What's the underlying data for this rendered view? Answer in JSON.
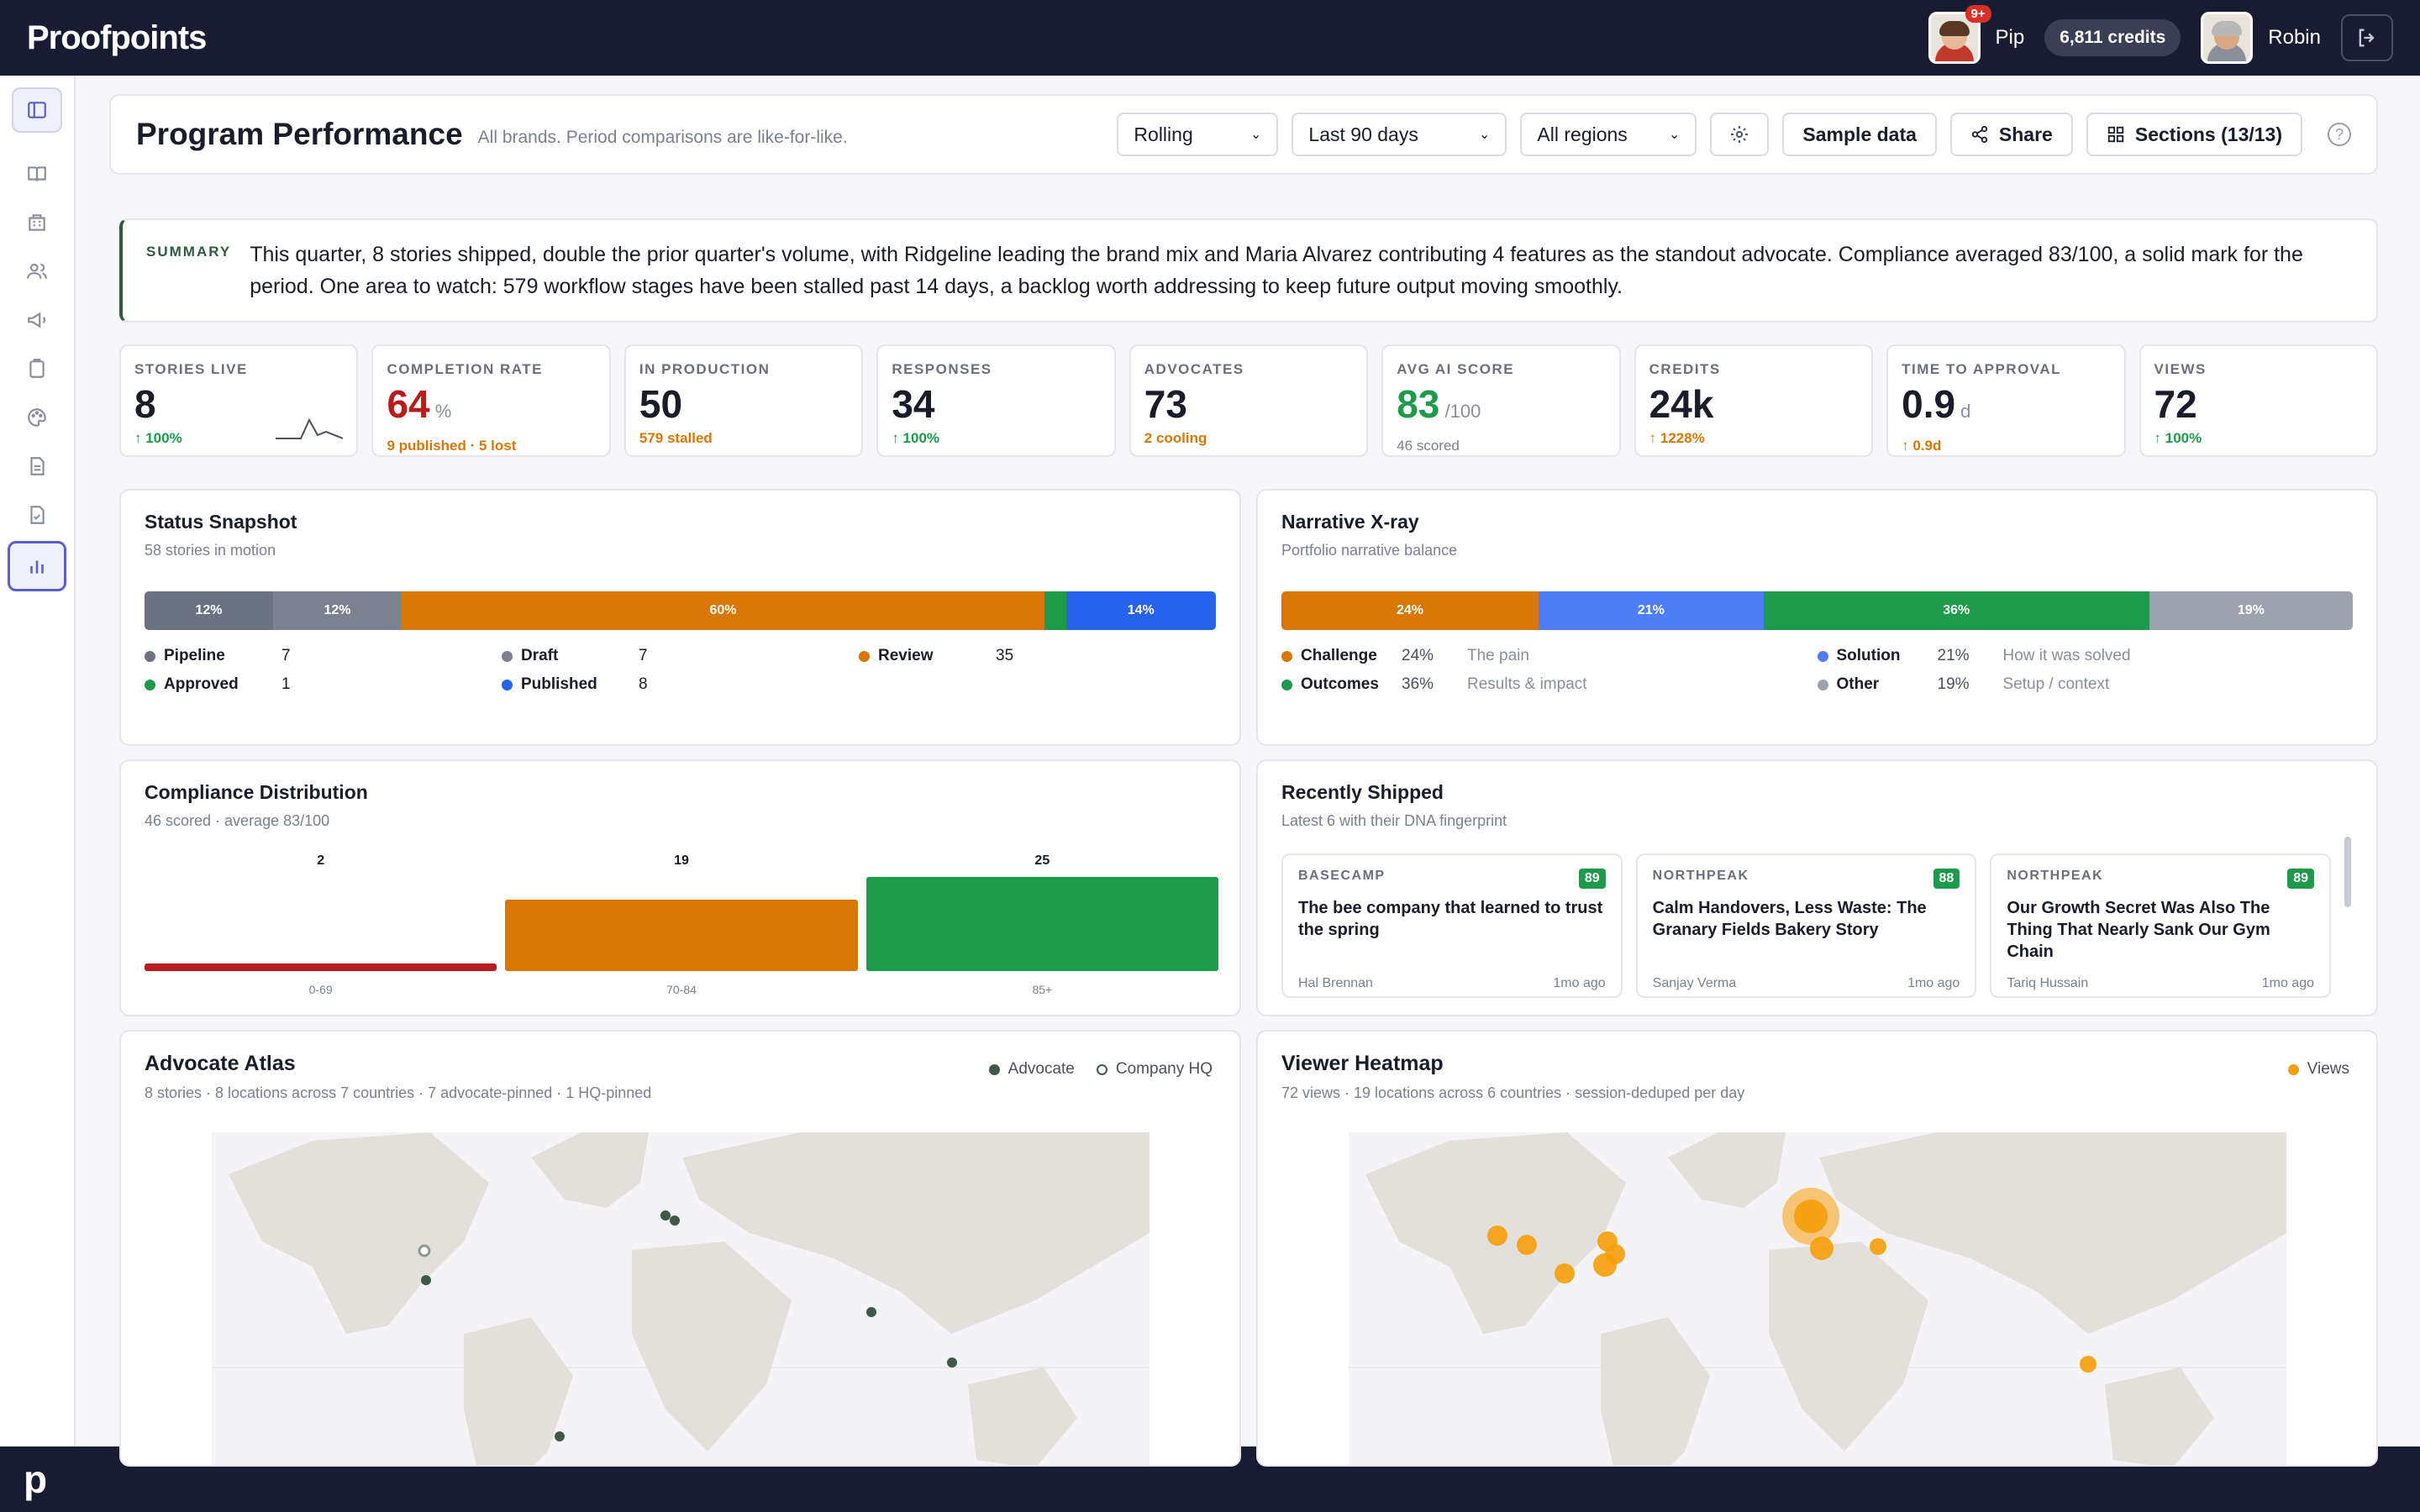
{
  "app": {
    "logo": "Proofpoints",
    "bottom_mark": "p"
  },
  "topbar": {
    "user1": {
      "name": "Pip",
      "badge": "9+"
    },
    "credits": "6,811 credits",
    "user2": {
      "name": "Robin"
    }
  },
  "header": {
    "title": "Program Performance",
    "subtitle": "All brands. Period comparisons are like-for-like.",
    "mode_select": "Rolling",
    "period_select": "Last 90 days",
    "region_select": "All regions",
    "sample_label": "Sample data",
    "share_label": "Share",
    "sections_label": "Sections (13/13)",
    "help": "?"
  },
  "summary": {
    "label": "SUMMARY",
    "text": "This quarter, 8 stories shipped, double the prior quarter's volume, with Ridgeline leading the brand mix and Maria Alvarez contributing 4 features as the standout advocate. Compliance averaged 83/100, a solid mark for the period. One area to watch: 579 workflow stages have been stalled past 14 days, a backlog worth addressing to keep future output moving smoothly."
  },
  "kpis": [
    {
      "label": "STORIES LIVE",
      "value": "8",
      "unit": "",
      "foot": "↑ 100%",
      "value_color": "#1a1d29",
      "foot_color": "#1d9a4a"
    },
    {
      "label": "COMPLETION RATE",
      "value": "64",
      "unit": "%",
      "foot": "9 published · 5 lost",
      "value_color": "#b91c1c",
      "foot_color": "#d97706"
    },
    {
      "label": "IN PRODUCTION",
      "value": "50",
      "unit": "",
      "foot": "579 stalled",
      "value_color": "#1a1d29",
      "foot_color": "#d97706"
    },
    {
      "label": "RESPONSES",
      "value": "34",
      "unit": "",
      "foot": "↑ 100%",
      "value_color": "#1a1d29",
      "foot_color": "#1d9a4a"
    },
    {
      "label": "ADVOCATES",
      "value": "73",
      "unit": "",
      "foot": "2 cooling",
      "value_color": "#1a1d29",
      "foot_color": "#d97706"
    },
    {
      "label": "AVG AI SCORE",
      "value": "83",
      "unit": "/100",
      "foot": "46 scored",
      "value_color": "#1d9a4a",
      "foot_color": "#7b7f8e"
    },
    {
      "label": "CREDITS",
      "value": "24k",
      "unit": "",
      "foot": "↑ 1228%",
      "value_color": "#1a1d29",
      "foot_color": "#d97706"
    },
    {
      "label": "TIME TO APPROVAL",
      "value": "0.9",
      "unit": "d",
      "foot": "↑ 0.9d",
      "value_color": "#1a1d29",
      "foot_color": "#d97706"
    },
    {
      "label": "VIEWS",
      "value": "72",
      "unit": "",
      "foot": "↑ 100%",
      "value_color": "#1a1d29",
      "foot_color": "#1d9a4a"
    }
  ],
  "status": {
    "title": "Status Snapshot",
    "subtitle": "58 stories in motion",
    "segments": [
      {
        "label": "12%",
        "share": 12,
        "color": "#6b7280"
      },
      {
        "label": "12%",
        "share": 12,
        "color": "#7b8190"
      },
      {
        "label": "60%",
        "share": 60,
        "color": "#d97706"
      },
      {
        "label": "",
        "share": 2,
        "color": "#1d9a4a"
      },
      {
        "label": "14%",
        "share": 14,
        "color": "#2563eb"
      }
    ],
    "legend": [
      {
        "name": "Pipeline",
        "count": "7",
        "color": "#6b7280"
      },
      {
        "name": "Draft",
        "count": "7",
        "color": "#7b8190"
      },
      {
        "name": "Review",
        "count": "35",
        "color": "#d97706"
      },
      {
        "name": "Approved",
        "count": "1",
        "color": "#1d9a4a"
      },
      {
        "name": "Published",
        "count": "8",
        "color": "#2563eb"
      }
    ]
  },
  "narrative": {
    "title": "Narrative X-ray",
    "subtitle": "Portfolio narrative balance",
    "segments": [
      {
        "label": "24%",
        "share": 24,
        "color": "#d97706"
      },
      {
        "label": "21%",
        "share": 21,
        "color": "#4f7df3"
      },
      {
        "label": "36%",
        "share": 36,
        "color": "#1d9a4a"
      },
      {
        "label": "19%",
        "share": 19,
        "color": "#9ca3af"
      }
    ],
    "legend": [
      {
        "name": "Challenge",
        "pct": "24%",
        "desc": "The pain",
        "color": "#d97706"
      },
      {
        "name": "Solution",
        "pct": "21%",
        "desc": "How it was solved",
        "color": "#4f7df3"
      },
      {
        "name": "Outcomes",
        "pct": "36%",
        "desc": "Results & impact",
        "color": "#1d9a4a"
      },
      {
        "name": "Other",
        "pct": "19%",
        "desc": "Setup / context",
        "color": "#9ca3af"
      }
    ]
  },
  "compliance": {
    "title": "Compliance Distribution",
    "subtitle": "46 scored · average 83/100"
  },
  "chart_data": {
    "type": "bar",
    "categories": [
      "0-69",
      "70-84",
      "85+"
    ],
    "values": [
      2,
      19,
      25
    ],
    "colors": [
      "#b91c1c",
      "#d97706",
      "#1d9a4a"
    ],
    "title": "",
    "ylim": [
      0,
      25
    ]
  },
  "shipped": {
    "title": "Recently Shipped",
    "subtitle": "Latest 6 with their DNA fingerprint",
    "items": [
      {
        "brand": "BASECAMP",
        "score": "89",
        "title": "The bee company that learned to trust the spring",
        "author": "Hal Brennan",
        "when": "1mo ago"
      },
      {
        "brand": "NORTHPEAK",
        "score": "88",
        "title": "Calm Handovers, Less Waste: The Granary Fields Bakery Story",
        "author": "Sanjay Verma",
        "when": "1mo ago"
      },
      {
        "brand": "NORTHPEAK",
        "score": "89",
        "title": "Our Growth Secret Was Also The Thing That Nearly Sank Our Gym Chain",
        "author": "Tariq Hussain",
        "when": "1mo ago"
      }
    ]
  },
  "atlas": {
    "title": "Advocate Atlas",
    "subtitle": "8 stories · 8 locations across 7 countries · 7 advocate-pinned · 1 HQ-pinned",
    "legend_advocate": "Advocate",
    "legend_hq": "Company HQ"
  },
  "heatmap": {
    "title": "Viewer Heatmap",
    "subtitle": "72 views · 19 locations across 6 countries · session-deduped per day",
    "legend_views": "Views"
  }
}
